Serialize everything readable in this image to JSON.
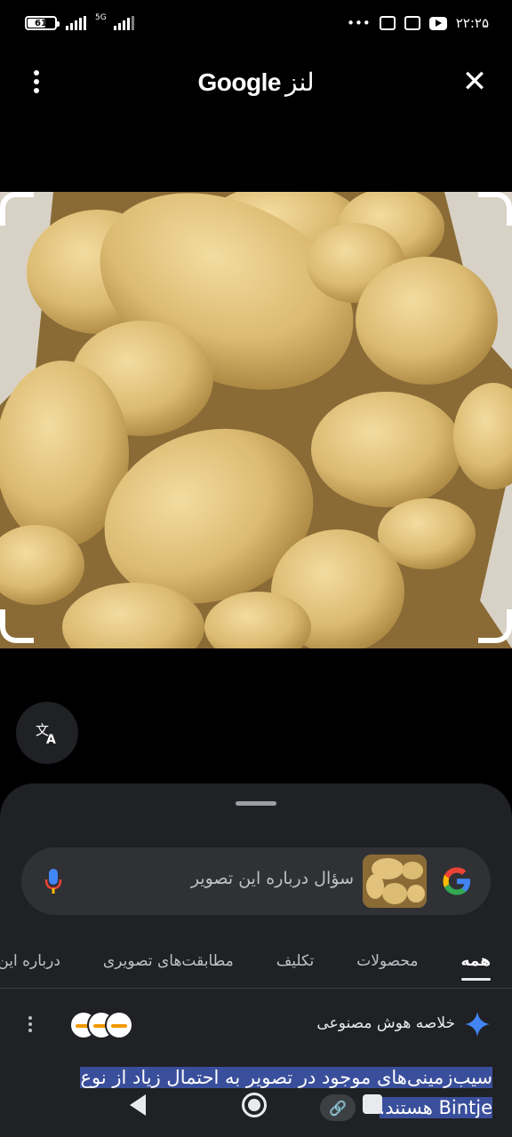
{
  "status_bar": {
    "battery": "61",
    "battery_level": 0.61,
    "network": "5G",
    "dots": "•••",
    "time": "۲۲:۲۵"
  },
  "header": {
    "brand": "Google",
    "title": "لنز",
    "menu_icon": "more-vert-icon",
    "close_icon": "close-icon"
  },
  "translate": {
    "icon": "translate-icon"
  },
  "search": {
    "placeholder": "سؤال درباره این تصویر",
    "mic_icon": "mic-icon",
    "logo_icon": "google-g-icon"
  },
  "tabs": [
    {
      "label": "همه",
      "active": true
    },
    {
      "label": "محصولات",
      "active": false
    },
    {
      "label": "تکلیف",
      "active": false
    },
    {
      "label": "مطابقت‌های تصویری",
      "active": false
    },
    {
      "label": "درباره این تصویر",
      "active": false
    }
  ],
  "ai_overview": {
    "title": "خلاصه هوش مصنوعی",
    "icon": "sparkle-icon",
    "summary": "سیب‌زمینی‌های موجود در تصویر به احتمال زیاد از نوع Bintje هستند."
  },
  "colors": {
    "sheet": "#202124",
    "search_box": "#303134",
    "highlight": "#3a4f9c",
    "accent_blue": "#4285f4"
  }
}
